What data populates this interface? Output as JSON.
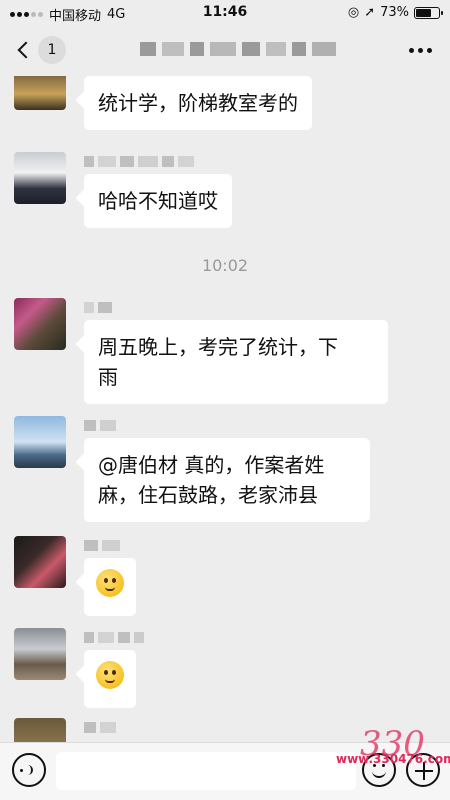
{
  "status_bar": {
    "carrier": "中国移动",
    "network": "4G",
    "time": "11:46",
    "battery_percent": "73%",
    "battery_level": 0.73
  },
  "nav": {
    "unread_count": "1"
  },
  "messages": [
    {
      "text": "统计学，阶梯教室考的"
    },
    {
      "text": "哈哈不知道哎"
    },
    {
      "time_divider": "10:02"
    },
    {
      "text": "周五晚上，考完了统计，下雨",
      "line1": "周五晚上，考完了统计，下",
      "line2": "雨"
    },
    {
      "text": "@唐伯材 真的，作案者姓麻，住石鼓路，老家沛县",
      "line1": "@唐伯材 真的，作案者姓",
      "line2": "麻，住石鼓路，老家沛县"
    },
    {
      "emoji": "crying-laughing-emoji"
    },
    {
      "emoji": "sweat-smile-emoji"
    }
  ],
  "watermark": {
    "text": "www.330476.com",
    "logo_text": "330"
  },
  "colors": {
    "background": "#ededed",
    "bubble": "#ffffff",
    "watermark": "#e0285a"
  }
}
